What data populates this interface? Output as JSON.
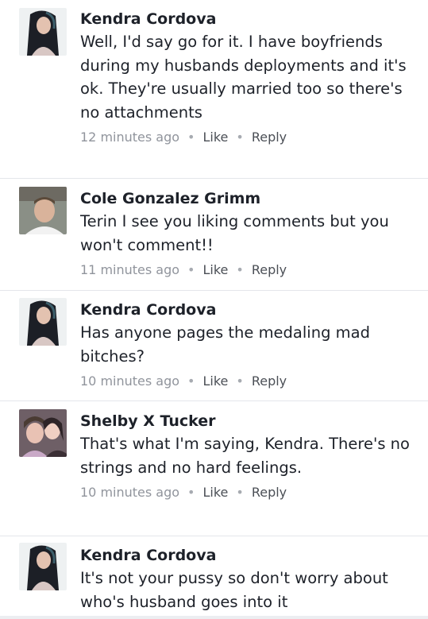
{
  "comments": [
    {
      "author": "Kendra Cordova",
      "text": "Well, I'd say go for it. I have boyfriends during my husbands deployments and it's ok. They're usually married too so there's no attachments",
      "time": "12 minutes ago",
      "like_label": "Like",
      "reply_label": "Reply",
      "separator": "•"
    },
    {
      "author": "Cole Gonzalez Grimm",
      "text": "Terin I see you liking comments but you won't comment!!",
      "time": "11 minutes ago",
      "like_label": "Like",
      "reply_label": "Reply",
      "separator": "•"
    },
    {
      "author": "Kendra Cordova",
      "text": "Has anyone pages the medaling mad bitches?",
      "time": "10 minutes ago",
      "like_label": "Like",
      "reply_label": "Reply",
      "separator": "•"
    },
    {
      "author": "Shelby X Tucker",
      "text": "That's what I'm saying, Kendra. There's no strings and no hard feelings.",
      "time": "10 minutes ago",
      "like_label": "Like",
      "reply_label": "Reply",
      "separator": "•"
    },
    {
      "author": "Kendra Cordova",
      "text": "It's not your pussy so don't worry about who's husband goes into it",
      "time": "",
      "like_label": "",
      "reply_label": "",
      "separator": ""
    }
  ],
  "colors": {
    "text": "#1d2129",
    "meta": "#90949c",
    "link": "#4b4f56"
  }
}
